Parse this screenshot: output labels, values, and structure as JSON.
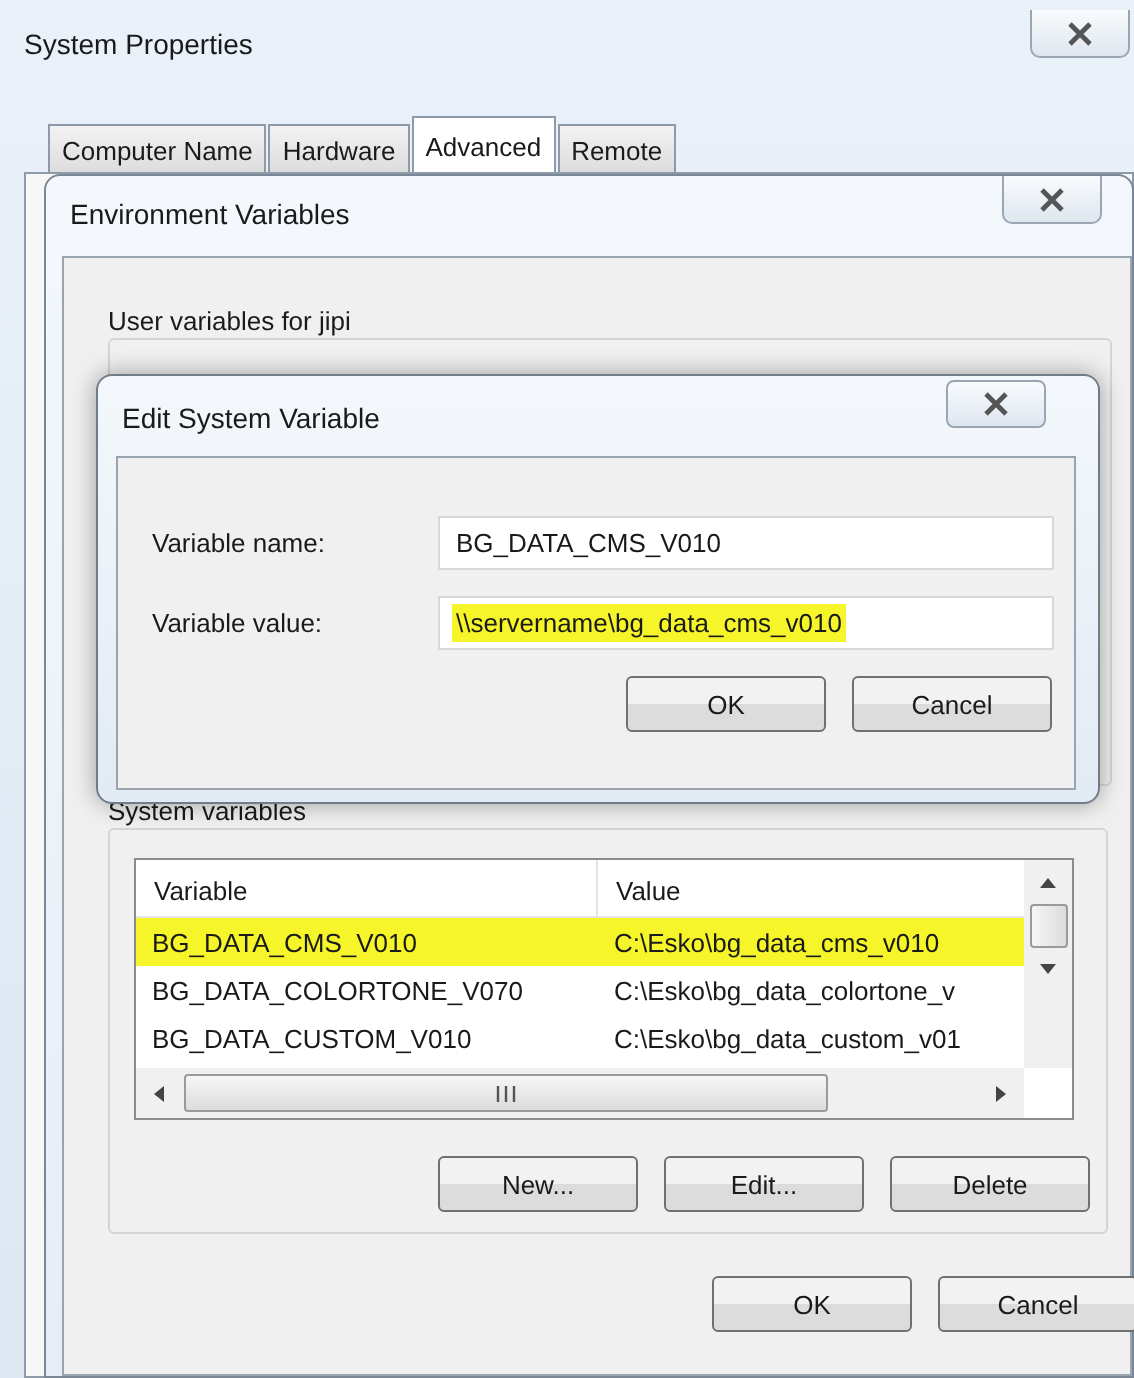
{
  "window": {
    "title": "System Properties"
  },
  "tabs": [
    {
      "label": "Computer Name",
      "selected": false
    },
    {
      "label": "Hardware",
      "selected": false
    },
    {
      "label": "Advanced",
      "selected": true
    },
    {
      "label": "Remote",
      "selected": false
    }
  ],
  "environment_dialog": {
    "title": "Environment Variables",
    "user_group_label": "User variables for jipi",
    "system_group_label": "System variables",
    "system_table": {
      "columns": [
        "Variable",
        "Value"
      ],
      "rows": [
        {
          "variable": "BG_DATA_CMS_V010",
          "value": "C:\\Esko\\bg_data_cms_v010",
          "highlighted": true
        },
        {
          "variable": "BG_DATA_COLORTONE_V070",
          "value": "C:\\Esko\\bg_data_colortone_v",
          "highlighted": false
        },
        {
          "variable": "BG_DATA_CUSTOM_V010",
          "value": "C:\\Esko\\bg_data_custom_v01",
          "highlighted": false
        }
      ]
    },
    "table_buttons": [
      "New...",
      "Edit...",
      "Delete"
    ],
    "buttons": [
      "OK",
      "Cancel"
    ]
  },
  "edit_dialog": {
    "title": "Edit System Variable",
    "fields": [
      {
        "label": "Variable name:",
        "value": "BG_DATA_CMS_V010",
        "highlighted": false
      },
      {
        "label": "Variable value:",
        "value": "\\\\servername\\bg_data_cms_v010",
        "highlighted": true
      }
    ],
    "buttons": [
      "OK",
      "Cancel"
    ]
  }
}
